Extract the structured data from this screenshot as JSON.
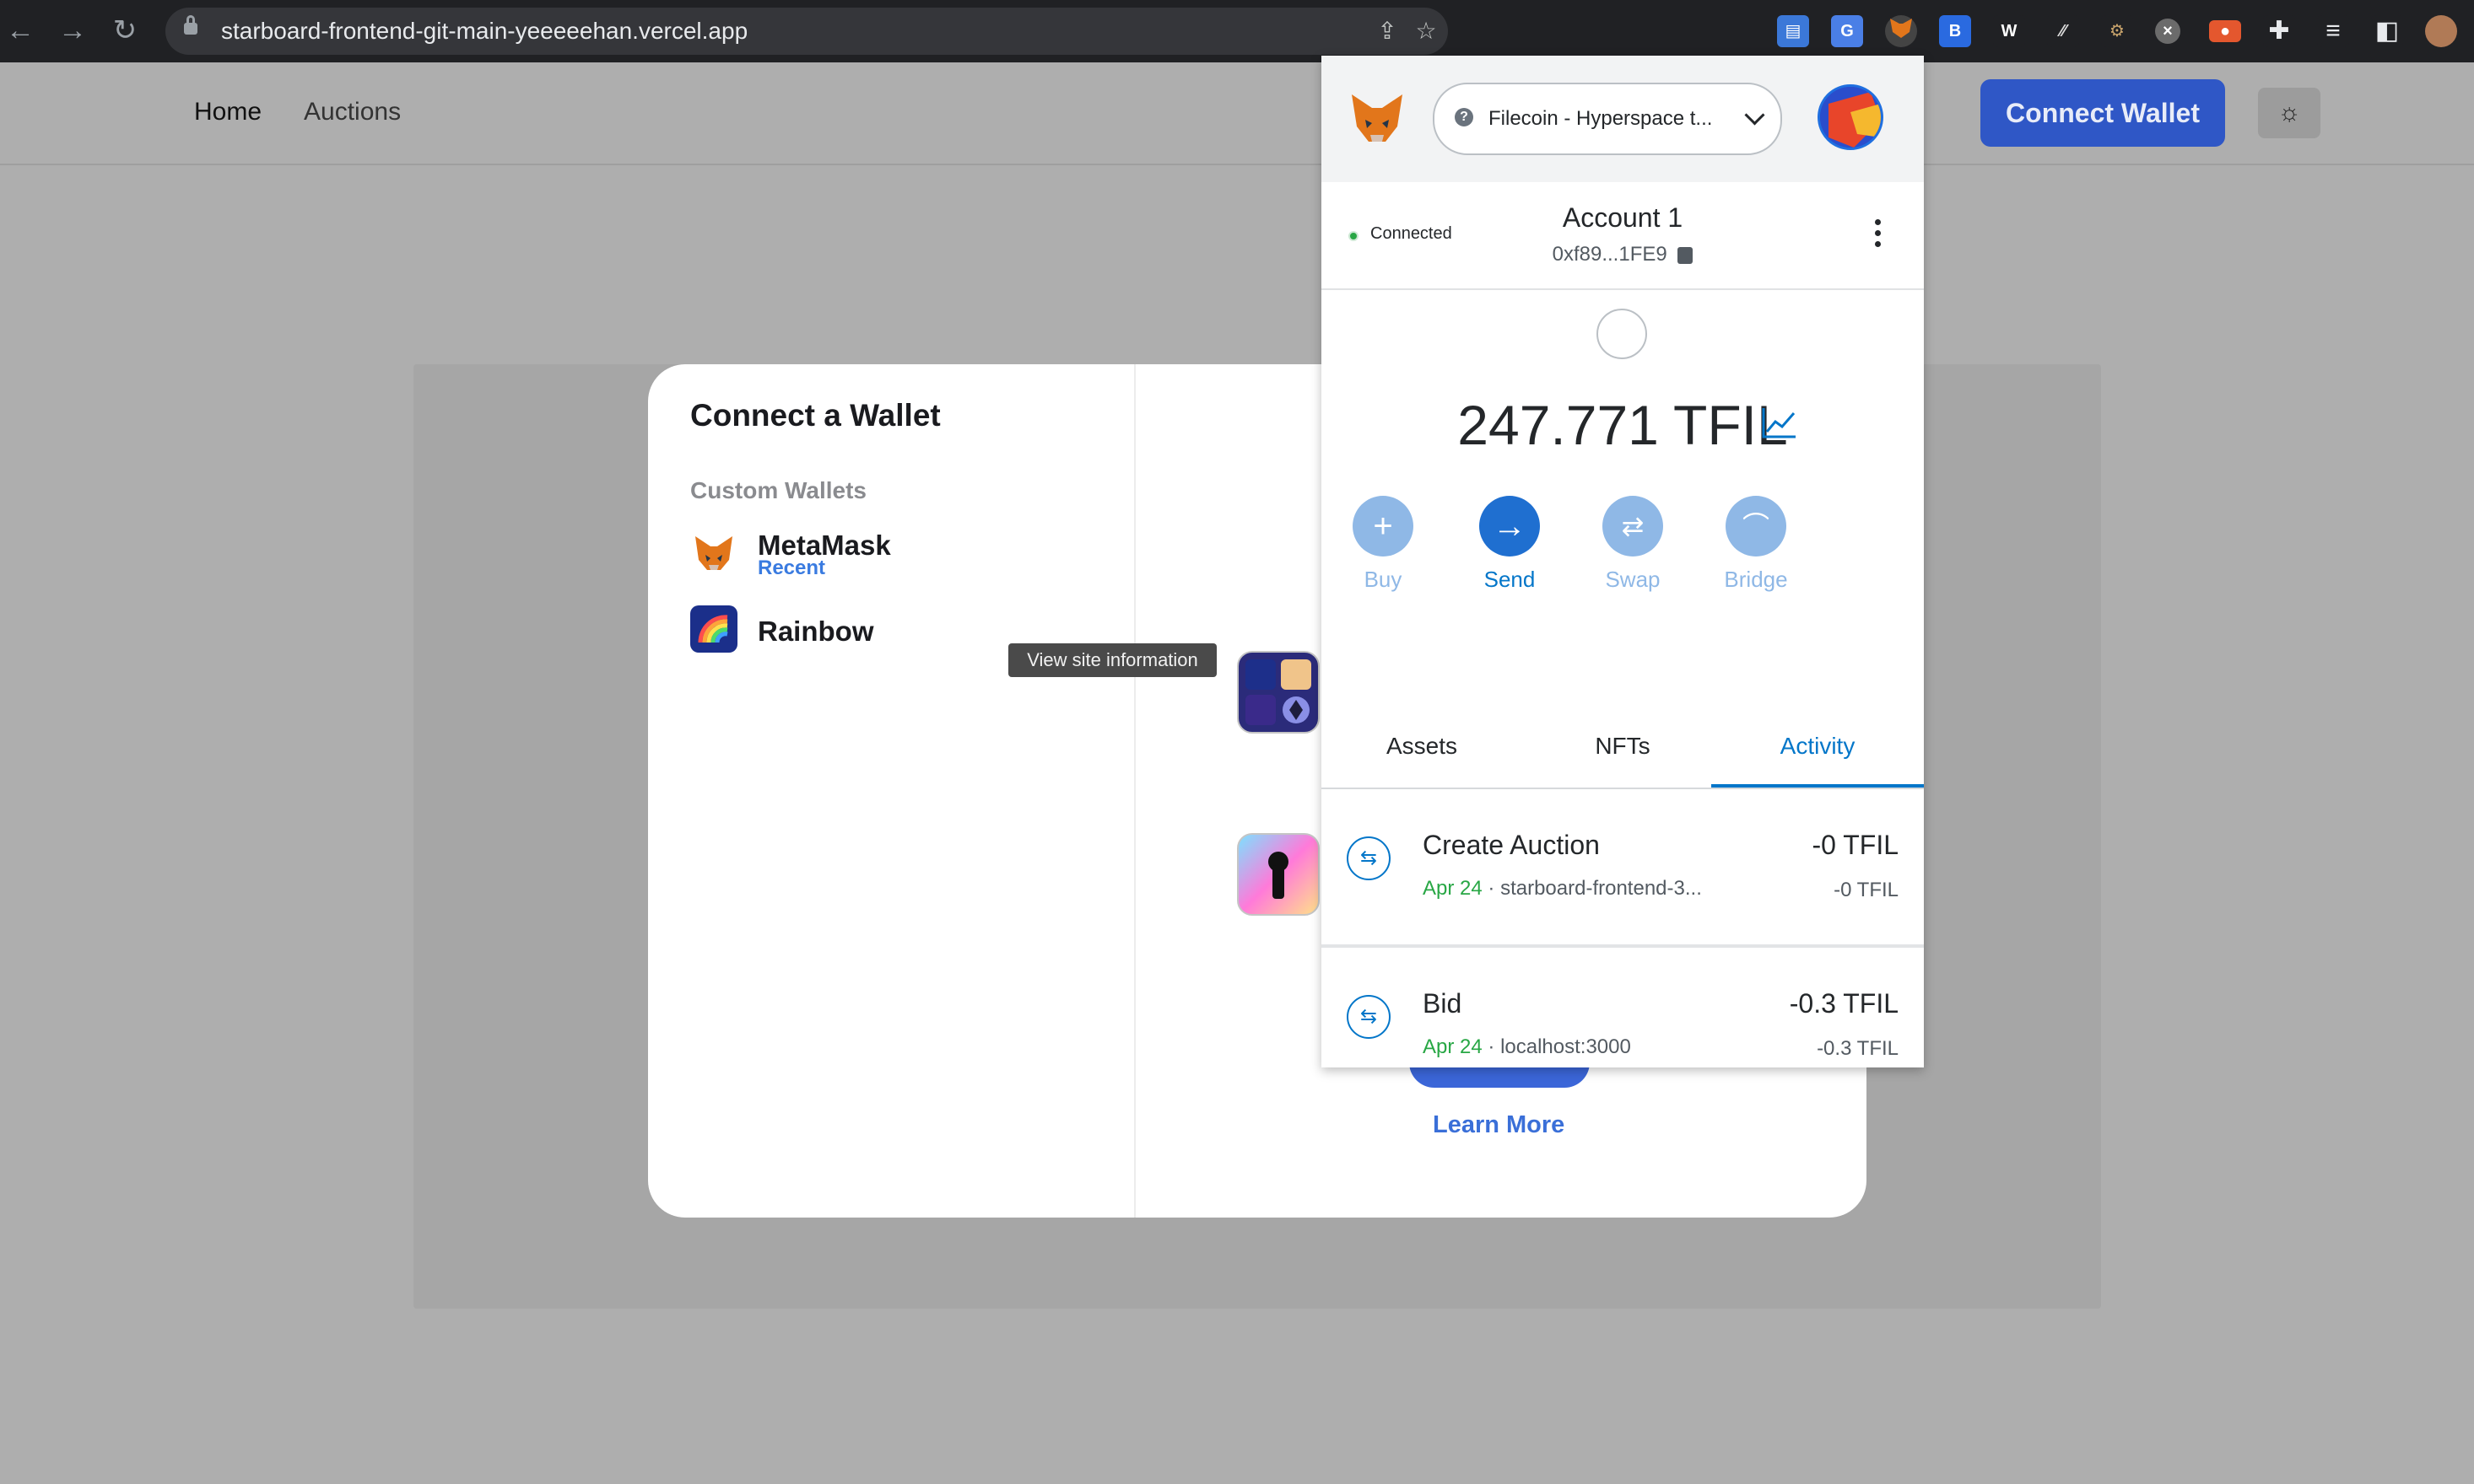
{
  "browser": {
    "url": "starboard-frontend-git-main-yeeeeehan.vercel.app"
  },
  "site": {
    "nav": {
      "home": "Home",
      "auctions": "Auctions"
    },
    "connect_wallet": "Connect Wallet"
  },
  "modal": {
    "title": "Connect a Wallet",
    "section": "Custom Wallets",
    "wallets": [
      {
        "name": "MetaMask",
        "tag": "Recent"
      },
      {
        "name": "Rainbow",
        "tag": ""
      }
    ],
    "learn_more": "Learn More"
  },
  "tooltip": "View site information",
  "metamask": {
    "network": "Filecoin - Hyperspace t...",
    "status": "Connected",
    "account_name": "Account 1",
    "address": "0xf89...1FE9",
    "balance": "247.771 TFIL",
    "actions": [
      {
        "label": "Buy",
        "icon": "plus-icon"
      },
      {
        "label": "Send",
        "icon": "arrow-right-icon"
      },
      {
        "label": "Swap",
        "icon": "swap-icon"
      },
      {
        "label": "Bridge",
        "icon": "bridge-icon"
      }
    ],
    "tabs": [
      "Assets",
      "NFTs",
      "Activity"
    ],
    "active_tab": "Activity",
    "transactions": [
      {
        "title": "Create Auction",
        "date": "Apr 24",
        "origin": "starboard-frontend-3...",
        "amount": "-0 TFIL",
        "amount_secondary": "-0 TFIL"
      },
      {
        "title": "Bid",
        "date": "Apr 24",
        "origin": "localhost:3000",
        "amount": "-0.3 TFIL",
        "amount_secondary": "-0.3 TFIL"
      }
    ]
  }
}
